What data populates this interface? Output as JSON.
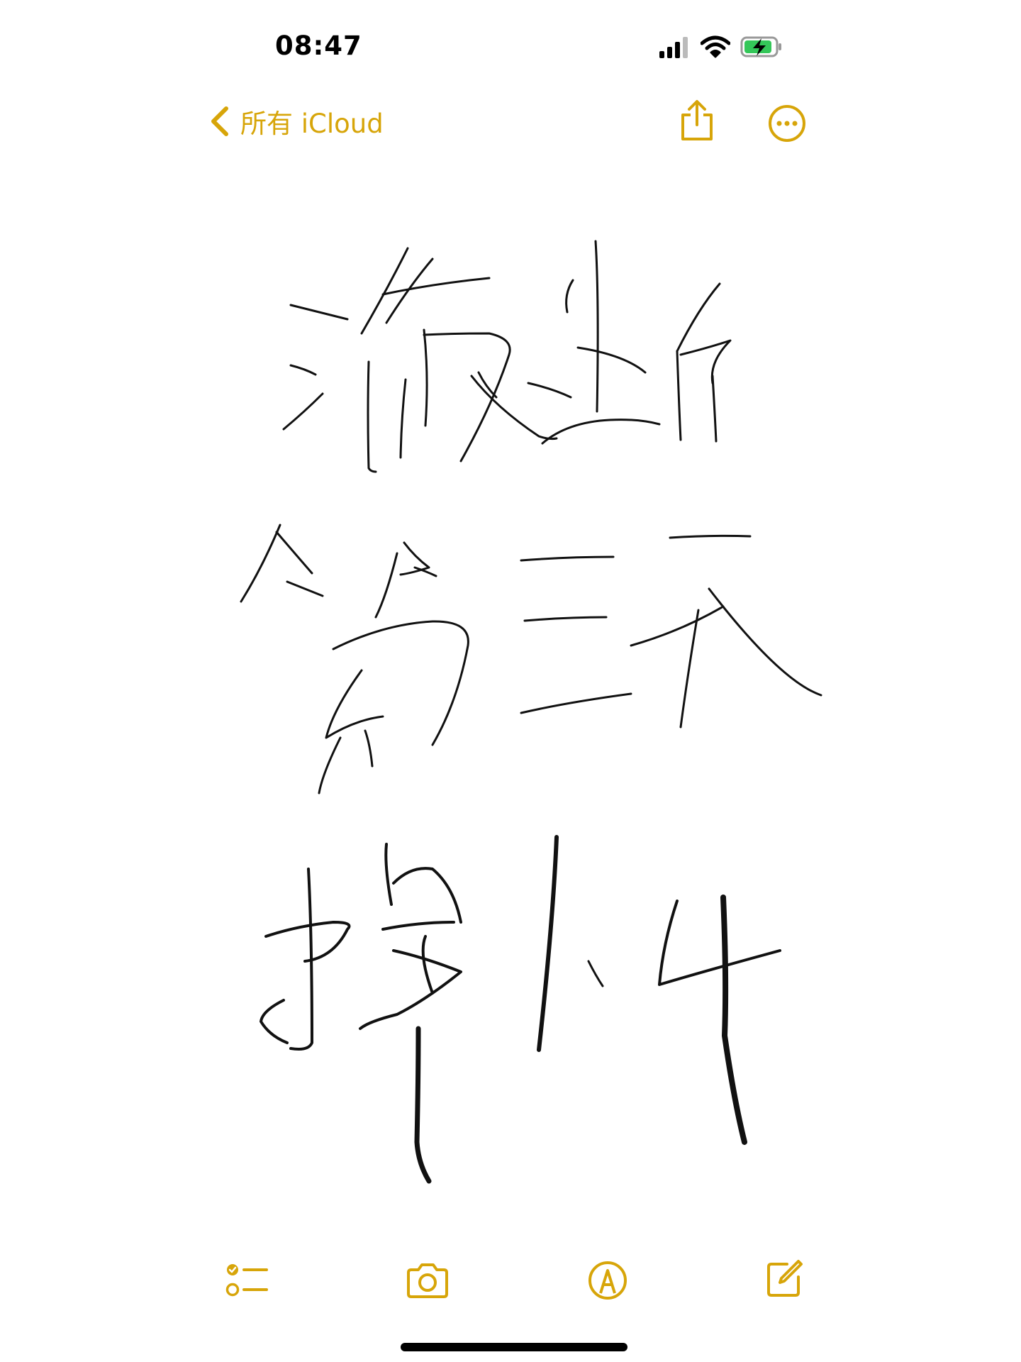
{
  "status_bar": {
    "time": "08:47"
  },
  "nav": {
    "back_label": "所有 iCloud"
  },
  "note": {
    "title": "",
    "date": ""
  },
  "colors": {
    "accent": "#d7a509",
    "ink": "#111111",
    "battery_charge": "#34c759"
  },
  "icons": {
    "back": "chevron-left-icon",
    "share": "share-icon",
    "more": "ellipsis-circle-icon",
    "checklist": "checklist-icon",
    "camera": "camera-icon",
    "markup": "markup-pen-icon",
    "compose": "compose-icon"
  }
}
